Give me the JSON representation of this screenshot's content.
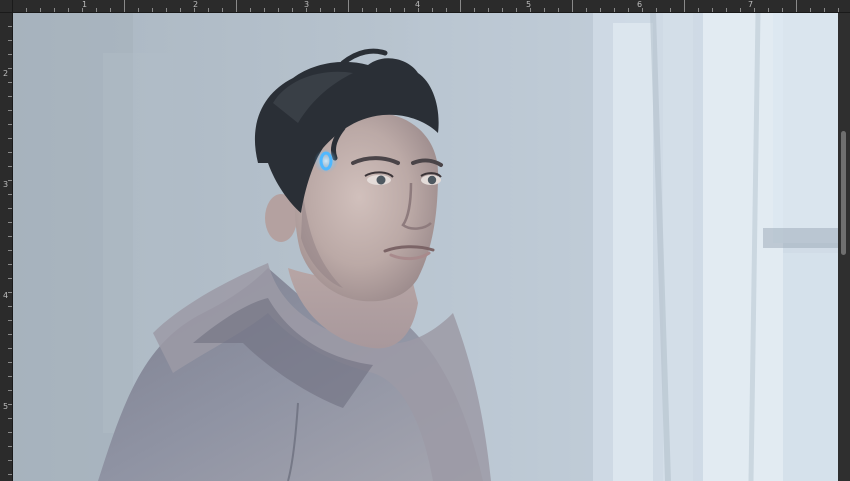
{
  "ruler": {
    "top_labels": [
      "1",
      "2",
      "3",
      "4",
      "5",
      "6",
      "7"
    ],
    "left_labels": [
      "2",
      "3",
      "4",
      "5"
    ]
  },
  "canvas": {
    "subject": "digital painting",
    "palette": {
      "background": "#b7c3cd",
      "window_light": "#dbe5ee",
      "hair": "#2a2f36",
      "skin": "#c4b2ae",
      "hoodie": "#8d909d",
      "led": "#4fb8ff"
    }
  },
  "scrollbar": {
    "orientation": "vertical"
  }
}
